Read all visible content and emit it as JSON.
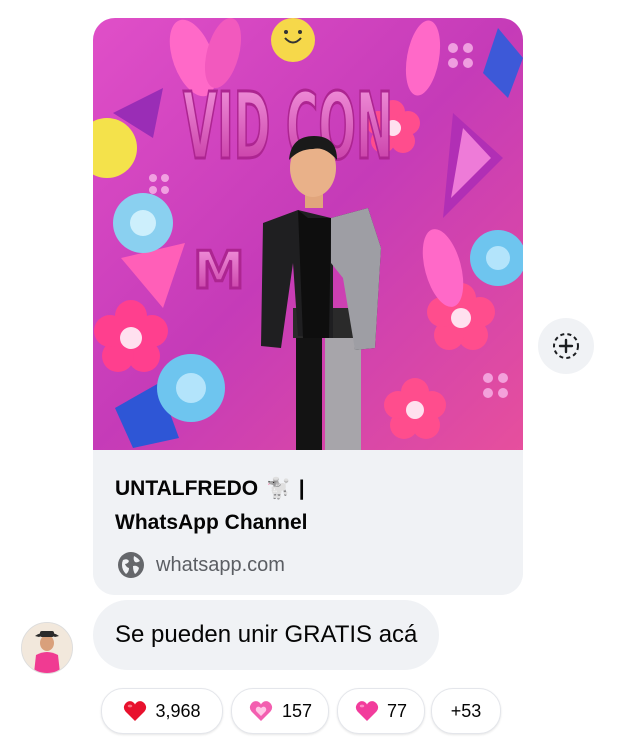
{
  "link_preview": {
    "title_part1": "UNTALFREDO",
    "title_emoji": "🐩",
    "title_sep": "|",
    "title_line2": "WhatsApp Channel",
    "domain": "whatsapp.com",
    "image_sign_text": "VID CON",
    "image_sign_partial": "M"
  },
  "message": {
    "text": "Se pueden unir GRATIS acá"
  },
  "reactions": [
    {
      "emoji": "red-heart-icon",
      "count": "3,968"
    },
    {
      "emoji": "sparkling-heart-icon",
      "count": "157"
    },
    {
      "emoji": "pink-heart-icon",
      "count": "77"
    },
    {
      "emoji": "",
      "count": "+53"
    }
  ],
  "colors": {
    "bubble": "#f0f2f5",
    "domain_text": "#5b5e63",
    "red_heart": "#e8112d",
    "pink_heart": "#f23c9c"
  }
}
